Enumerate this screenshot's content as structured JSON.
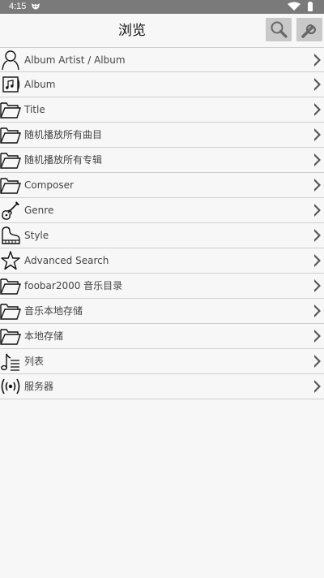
{
  "statusbar": {
    "time": "4:15",
    "app_icon": "app-notification-icon",
    "icons": [
      "wifi-icon",
      "battery-icon"
    ]
  },
  "header": {
    "title": "浏览",
    "search_icon": "search-icon",
    "settings_icon": "wrench-icon"
  },
  "rows": [
    {
      "label": "Album Artist / Album",
      "icon": "person-icon"
    },
    {
      "label": "Album",
      "icon": "album-icon"
    },
    {
      "label": "Title",
      "icon": "folder-icon"
    },
    {
      "label": "随机播放所有曲目",
      "icon": "folder-icon"
    },
    {
      "label": "随机播放所有专辑",
      "icon": "folder-icon"
    },
    {
      "label": "Composer",
      "icon": "folder-icon"
    },
    {
      "label": "Genre",
      "icon": "guitar-icon"
    },
    {
      "label": "Style",
      "icon": "piano-icon"
    },
    {
      "label": "Advanced Search",
      "icon": "star-icon"
    },
    {
      "label": "foobar2000 音乐目录",
      "icon": "folder-icon"
    },
    {
      "label": "音乐本地存储",
      "icon": "folder-icon"
    },
    {
      "label": "本地存储",
      "icon": "folder-icon"
    },
    {
      "label": "列表",
      "icon": "playlist-icon"
    },
    {
      "label": "服务器",
      "icon": "broadcast-icon"
    }
  ],
  "colors": {
    "statusbar": "#7a7a7a",
    "background": "#f7f7f7",
    "button": "#c9c9c9",
    "divider": "#cfcfcf"
  }
}
